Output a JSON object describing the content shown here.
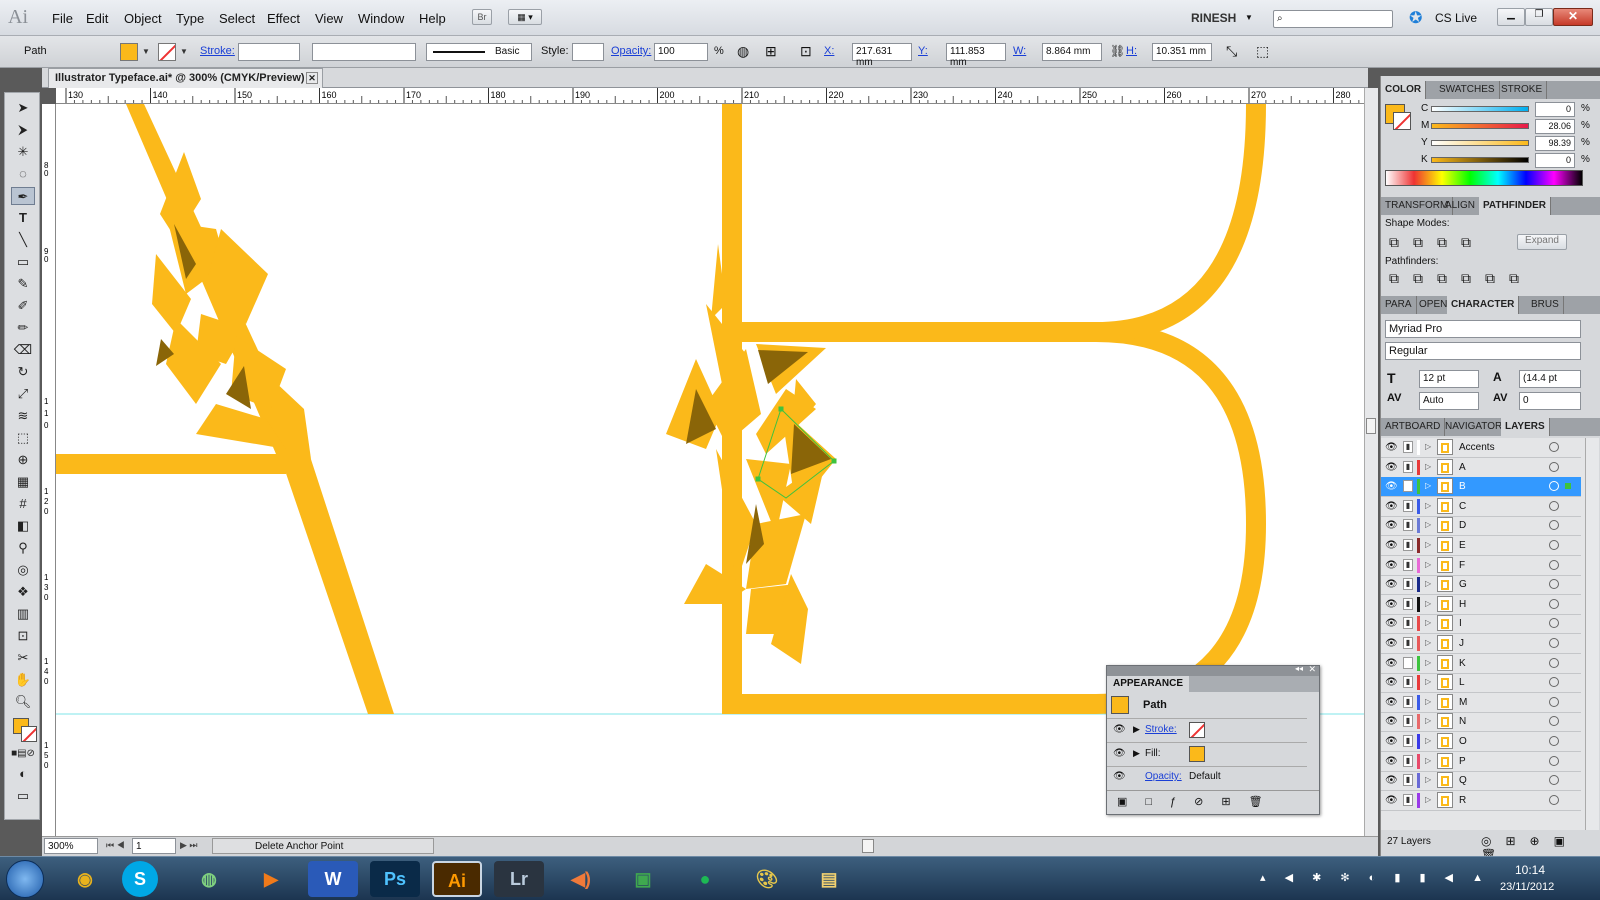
{
  "app": {
    "logo": "Ai",
    "bridge_button": "Br",
    "workspace": "RINESH",
    "cs_live": "CS Live"
  },
  "menu": [
    "File",
    "Edit",
    "Object",
    "Type",
    "Select",
    "Effect",
    "View",
    "Window",
    "Help"
  ],
  "control": {
    "selection_type": "Path",
    "stroke_label": "Stroke:",
    "brush_label": "Basic",
    "style_label": "Style:",
    "opacity_label": "Opacity:",
    "opacity_value": "100",
    "percent": "%",
    "x_label": "X:",
    "x_value": "217.631 mm",
    "y_label": "Y:",
    "y_value": "111.853 mm",
    "w_label": "W:",
    "w_value": "8.864 mm",
    "h_label": "H:",
    "h_value": "10.351 mm"
  },
  "document": {
    "tab_title": "Illustrator Typeface.ai* @ 300% (CMYK/Preview)"
  },
  "ruler": {
    "top_ticks": [
      "130",
      "140",
      "150",
      "160",
      "170",
      "180",
      "190",
      "200",
      "210",
      "220",
      "230",
      "240",
      "250",
      "260",
      "270",
      "280"
    ]
  },
  "status": {
    "zoom": "300%",
    "artboard": "1",
    "message": "Delete Anchor Point"
  },
  "color_panel": {
    "tabs": [
      "COLOR",
      "SWATCHES",
      "STROKE"
    ],
    "channels": [
      {
        "name": "C",
        "value": "0"
      },
      {
        "name": "M",
        "value": "28.06"
      },
      {
        "name": "Y",
        "value": "98.39"
      },
      {
        "name": "K",
        "value": "0"
      }
    ],
    "percent": "%"
  },
  "pathfinder_panel": {
    "tabs": [
      "TRANSFORM",
      "ALIGN",
      "PATHFINDER"
    ],
    "shape_modes": "Shape Modes:",
    "pathfinders": "Pathfinders:",
    "expand": "Expand"
  },
  "character_panel": {
    "tabs": [
      "PARA",
      "OPEN",
      "CHARACTER",
      "BRUS"
    ],
    "font": "Myriad Pro",
    "style": "Regular",
    "size": "12 pt",
    "leading": "(14.4 pt",
    "kerning": "Auto",
    "tracking": "0"
  },
  "layers_panel": {
    "tabs": [
      "ARTBOARD",
      "NAVIGATOR",
      "LAYERS"
    ],
    "layers": [
      {
        "name": "Accents",
        "color": "#ffffff"
      },
      {
        "name": "A",
        "color": "#e83a3a"
      },
      {
        "name": "B",
        "color": "#3ec33e"
      },
      {
        "name": "C",
        "color": "#3a5be8"
      },
      {
        "name": "D",
        "color": "#6b7bd6"
      },
      {
        "name": "E",
        "color": "#8a2a2a"
      },
      {
        "name": "F",
        "color": "#e86ad6"
      },
      {
        "name": "G",
        "color": "#1a2b8a"
      },
      {
        "name": "H",
        "color": "#111111"
      },
      {
        "name": "I",
        "color": "#e84a4a"
      },
      {
        "name": "J",
        "color": "#e85a5a"
      },
      {
        "name": "K",
        "color": "#3ec33e"
      },
      {
        "name": "L",
        "color": "#e83a3a"
      },
      {
        "name": "M",
        "color": "#3a5be8"
      },
      {
        "name": "N",
        "color": "#e86a6a"
      },
      {
        "name": "O",
        "color": "#3a3ae8"
      },
      {
        "name": "P",
        "color": "#e84a6a"
      },
      {
        "name": "Q",
        "color": "#6a6ad6"
      },
      {
        "name": "R",
        "color": "#9a3ae8"
      }
    ],
    "count": "27 Layers",
    "selected": "B"
  },
  "appearance_panel": {
    "title": "APPEARANCE",
    "object": "Path",
    "stroke_label": "Stroke:",
    "fill_label": "Fill:",
    "opacity_label": "Opacity:",
    "opacity_value": "Default"
  },
  "taskbar": {
    "time": "10:14",
    "date": "23/11/2012"
  },
  "colors": {
    "accent_yellow": "#fbb91a",
    "accent_dark": "#8a6508",
    "selection_blue": "#3399ff",
    "guide": "#7fe6ea"
  }
}
